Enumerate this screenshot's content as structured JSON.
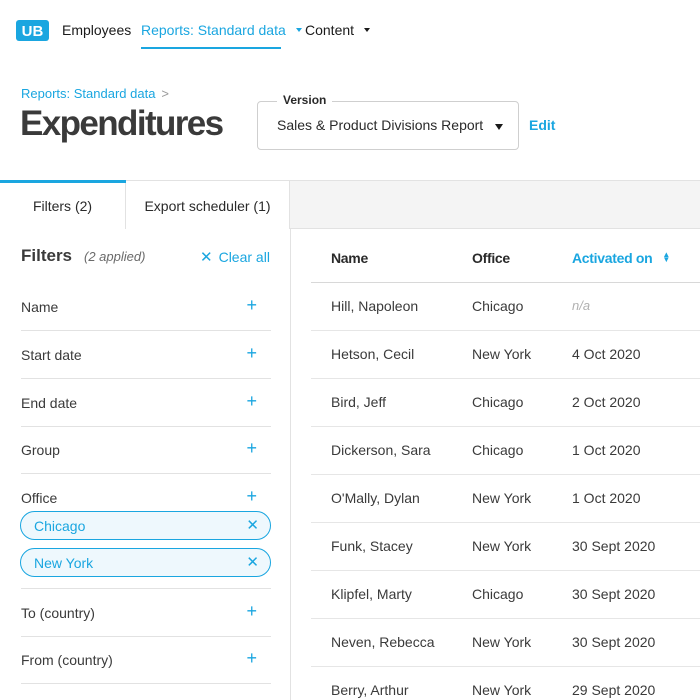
{
  "nav": {
    "logo": "UB",
    "items": [
      {
        "label": "Employees",
        "active": false
      },
      {
        "label": "Reports: Standard data",
        "active": true
      },
      {
        "label": "Content",
        "active": false
      }
    ]
  },
  "header": {
    "breadcrumb": "Reports: Standard data",
    "breadcrumb_sep": ">",
    "title": "Expenditures",
    "version_label": "Version",
    "version_value": "Sales & Product Divisions Report",
    "edit_label": "Edit"
  },
  "tabs": [
    {
      "label": "Filters (2)",
      "active": true
    },
    {
      "label": "Export scheduler (1)",
      "active": false
    }
  ],
  "filters": {
    "heading": "Filters",
    "applied": "(2 applied)",
    "clear_all": "Clear all",
    "items": [
      {
        "label": "Name"
      },
      {
        "label": "Start date"
      },
      {
        "label": "End date"
      },
      {
        "label": "Group"
      },
      {
        "label": "Office"
      },
      {
        "label": "To (country)"
      },
      {
        "label": "From (country)"
      }
    ],
    "office_chips": [
      "Chicago",
      "New York"
    ]
  },
  "table": {
    "columns": [
      "Name",
      "Office",
      "Activated on"
    ],
    "sorted_column": "Activated on",
    "rows": [
      {
        "name": "Hill, Napoleon",
        "office": "Chicago",
        "date": "n/a"
      },
      {
        "name": "Hetson, Cecil",
        "office": "New York",
        "date": "4 Oct 2020"
      },
      {
        "name": "Bird, Jeff",
        "office": "Chicago",
        "date": "2 Oct 2020"
      },
      {
        "name": "Dickerson, Sara",
        "office": "Chicago",
        "date": "1 Oct 2020"
      },
      {
        "name": "O'Mally, Dylan",
        "office": "New York",
        "date": "1 Oct 2020"
      },
      {
        "name": "Funk, Stacey",
        "office": "New York",
        "date": "30 Sept 2020"
      },
      {
        "name": "Klipfel, Marty",
        "office": "Chicago",
        "date": "30 Sept 2020"
      },
      {
        "name": "Neven, Rebecca",
        "office": "New York",
        "date": "30 Sept 2020"
      },
      {
        "name": "Berry, Arthur",
        "office": "New York",
        "date": "29 Sept 2020"
      }
    ]
  },
  "colors": {
    "accent": "#1aa6e0",
    "text": "#2a2a2a",
    "border": "#e2e2e2"
  },
  "icons": {
    "plus": "plus-icon",
    "close": "close-icon",
    "sort": "sort-icon",
    "dropdown": "chevron-down-icon"
  }
}
